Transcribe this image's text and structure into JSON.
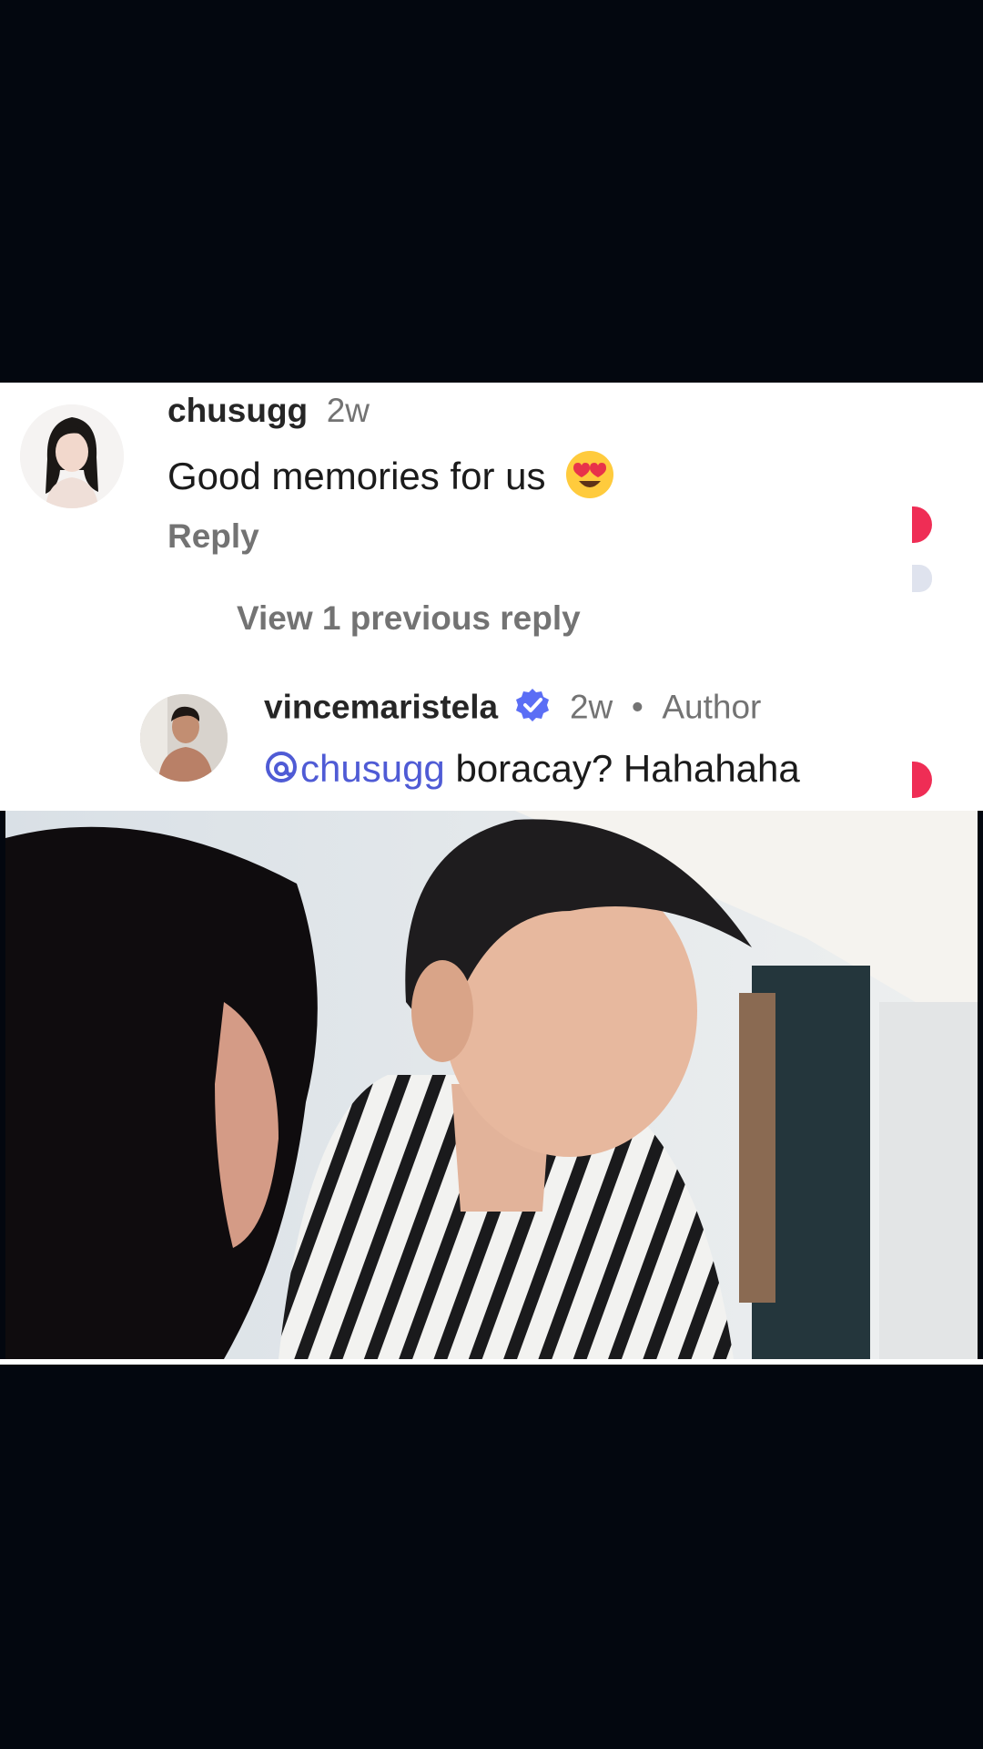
{
  "comments": [
    {
      "username": "chusugg",
      "time": "2w",
      "text": "Good memories for us",
      "emoji": "😍",
      "reply_label": "Reply"
    }
  ],
  "view_replies_label": "View 1 previous reply",
  "reply": {
    "username": "vincemaristela",
    "verified_icon": "verified-badge-icon",
    "time": "2w",
    "separator": "•",
    "author_label": "Author",
    "mention_icon": "threads-icon",
    "mention": "chusugg",
    "text": " boracay? Hahahaha"
  },
  "colors": {
    "background": "#03070f",
    "panel": "#ffffff",
    "username": "#262626",
    "meta": "#737373",
    "mention": "#4f5bd5",
    "verified": "#5b6ef5",
    "heart": "#ef2d55"
  }
}
